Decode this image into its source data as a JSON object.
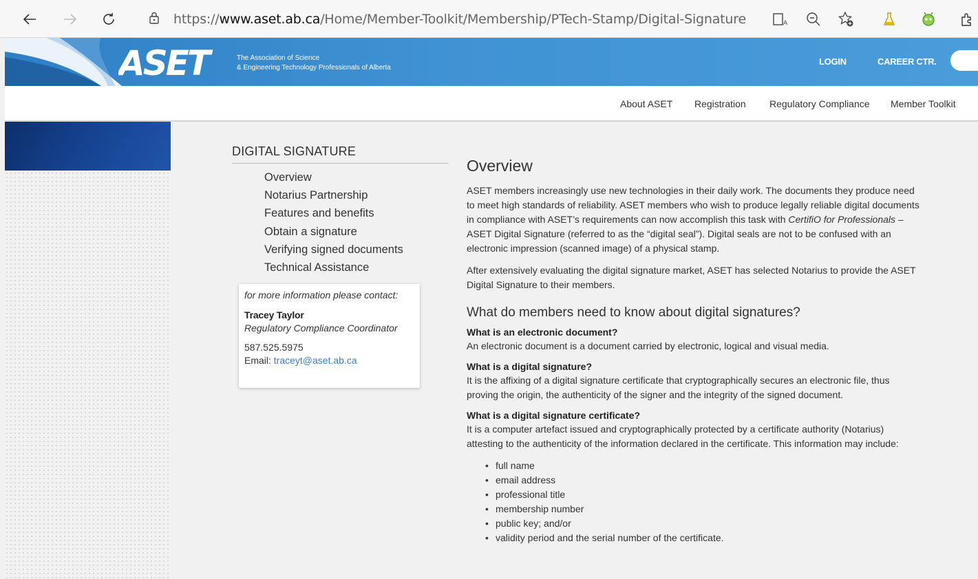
{
  "browser": {
    "url_prefix": "https://",
    "url_domain": "www.aset.ab.ca",
    "url_path": "/Home/Member-Toolkit/Membership/PTech-Stamp/Digital-Signature",
    "icons": [
      "back-icon",
      "forward-icon",
      "refresh-icon",
      "lock-icon",
      "read-aloud-icon",
      "zoom-out-icon",
      "favorites-icon",
      "flask-extension-icon",
      "bug-extension-icon",
      "extensions-icon"
    ]
  },
  "header": {
    "logo_text": "ASET",
    "tagline_line1": "The Association of Science",
    "tagline_line2": "& Engineering Technology Professionals of Alberta",
    "login": "LOGIN",
    "career": "CAREER CTR.",
    "brand_color": "#3a8bd0"
  },
  "nav": {
    "items": [
      "About ASET",
      "Registration",
      "Regulatory Compliance",
      "Member Toolkit"
    ]
  },
  "sidebar": {
    "title": "DIGITAL SIGNATURE",
    "items": [
      "Overview",
      "Notarius Partnership",
      "Features and benefits",
      "Obtain a signature",
      "Verifying signed documents",
      "Technical Assistance"
    ]
  },
  "contact": {
    "intro": "for more information please contact:",
    "name": "Tracey Taylor",
    "title": "Regulatory Compliance Coordinator",
    "phone": "587.525.5975",
    "email_label": "Email: ",
    "email": "traceyt@aset.ab.ca"
  },
  "content": {
    "title": "Overview",
    "para1_a": "ASET members increasingly use new technologies in their daily work. The documents they produce need to meet high standards of reliability. ASET members who wish to produce legally reliable digital documents in compliance with ASET’s requirements can now accomplish this task with ",
    "para1_em": "CertifiO for Professionals",
    "para1_b": " – ASET Digital Signature (referred to as the “digital seal”). Digital seals are not to be confused with an electronic impression (scanned image) of a physical stamp.",
    "para2": "After extensively evaluating the digital signature market, ASET has selected Notarius to provide the ASET Digital Signature to their members.",
    "subtitle": "What do members need to know about digital signatures?",
    "q1": "What is an electronic document?",
    "a1": "An electronic document is a document carried by electronic, logical and visual media.",
    "q2": "What is a digital signature?",
    "a2": "It is the affixing of a digital signature certificate that cryptographically secures an electronic file, thus proving the origin, the authenticity of the signer and the integrity of the signed document.",
    "q3": "What is a digital signature certificate?",
    "a3": "It is a computer artefact issued and cryptographically protected by a certificate authority (Notarius) attesting to the authenticity of the information declared in the certificate. This information may include:",
    "bullets": [
      "full name",
      "email address",
      "professional title",
      "membership number",
      "public key; and/or",
      "validity period and the serial number of the certificate."
    ]
  }
}
